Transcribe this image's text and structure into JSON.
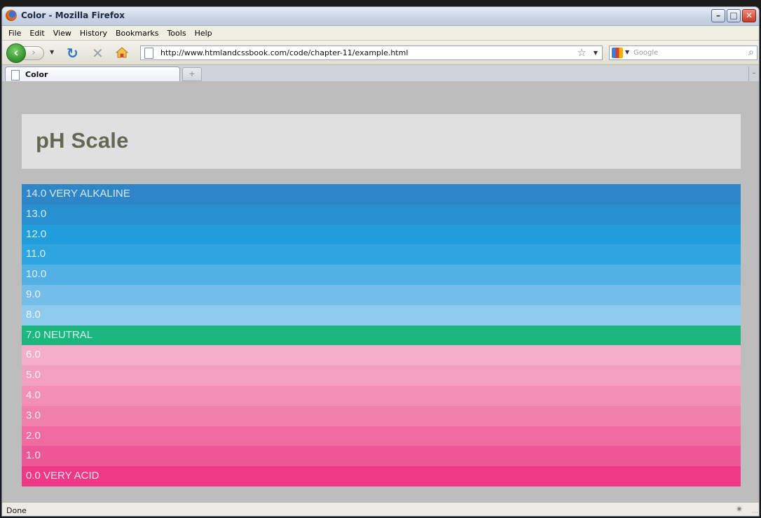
{
  "window": {
    "title": "Color - Mozilla Firefox"
  },
  "menu": [
    "File",
    "Edit",
    "View",
    "History",
    "Bookmarks",
    "Tools",
    "Help"
  ],
  "navigation": {
    "url": "http://www.htmlandcssbook.com/code/chapter-11/example.html",
    "search_placeholder": "Google"
  },
  "tabs": [
    {
      "label": "Color"
    }
  ],
  "page": {
    "title": "pH Scale",
    "scale": [
      {
        "label": "14.0 VERY ALKALINE",
        "color": "#2e85c8"
      },
      {
        "label": "13.0",
        "color": "#2990d0"
      },
      {
        "label": "12.0",
        "color": "#219ddc"
      },
      {
        "label": "11.0",
        "color": "#2fa5df"
      },
      {
        "label": "10.0",
        "color": "#52b1e4"
      },
      {
        "label": "9.0",
        "color": "#73bde8"
      },
      {
        "label": "8.0",
        "color": "#8ecaec"
      },
      {
        "label": "7.0 NEUTRAL",
        "color": "#1cb781"
      },
      {
        "label": "6.0",
        "color": "#f4aeca"
      },
      {
        "label": "5.0",
        "color": "#f39fc1"
      },
      {
        "label": "4.0",
        "color": "#f18fb7"
      },
      {
        "label": "3.0",
        "color": "#f07fac"
      },
      {
        "label": "2.0",
        "color": "#ef6ba0"
      },
      {
        "label": "1.0",
        "color": "#ee5795"
      },
      {
        "label": "0.0 VERY ACID",
        "color": "#ee3a86"
      }
    ]
  },
  "status": {
    "text": "Done"
  }
}
